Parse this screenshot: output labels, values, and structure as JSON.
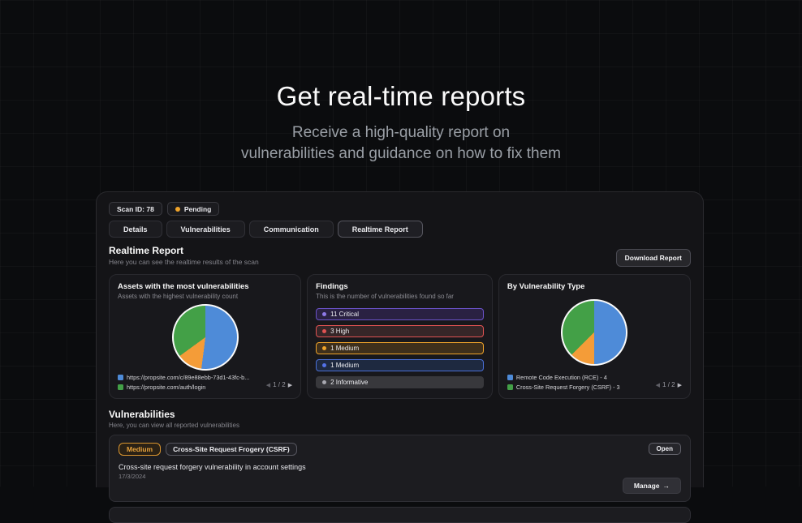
{
  "hero": {
    "title": "Get real-time reports",
    "subtitle_line1": "Receive a high-quality report on",
    "subtitle_line2": "vulnerabilities and guidance on how to fix them"
  },
  "panel": {
    "scan_badge": "Scan ID: 78",
    "status_badge": "Pending",
    "status_dot_color": "#f0a42a",
    "tabs": [
      {
        "label": "Details",
        "active": false
      },
      {
        "label": "Vulnerabilities",
        "active": false
      },
      {
        "label": "Communication",
        "active": false
      },
      {
        "label": "Realtime Report",
        "active": true
      }
    ],
    "section": {
      "title": "Realtime Report",
      "subtitle": "Here you can see the realtime results of the scan",
      "download_button": "Download Report"
    },
    "cards": {
      "assets": {
        "title": "Assets with the most vulnerabilities",
        "subtitle": "Assets with the highest vulnerability count",
        "legend": [
          {
            "color": "#4e8bd8",
            "label": "https://propsite.com/c/89e88ebb-73d1-43fc-b..."
          },
          {
            "color": "#43a047",
            "label": "https://propsite.com/auth/login"
          }
        ],
        "pagination": "1 / 2"
      },
      "findings": {
        "title": "Findings",
        "subtitle": "This is the number of vulnerabilities found so far",
        "rows": [
          {
            "label": "11 Critical",
            "dot": "#8f7ae8",
            "border": "#6a52c8",
            "bg": "#2a2142"
          },
          {
            "label": "3 High",
            "dot": "#e05252",
            "border": "#e05252",
            "bg": "#362628"
          },
          {
            "label": "1 Medium",
            "dot": "#f0a42a",
            "border": "#f0a42a",
            "bg": "#3e2f1b"
          },
          {
            "label": "1 Medium",
            "dot": "#5472e8",
            "border": "#4a6fd6",
            "bg": "#1e2940"
          },
          {
            "label": "2 Informative",
            "dot": "#a8a8b0",
            "border": "#38383c",
            "bg": "#38383c"
          }
        ]
      },
      "by_type": {
        "title": "By Vulnerability Type",
        "legend": [
          {
            "color": "#4e8bd8",
            "label": "Remote Code Execution (RCE) - 4"
          },
          {
            "color": "#43a047",
            "label": "Cross-Site Request Forgery (CSRF) - 3"
          }
        ],
        "pagination": "1 / 2"
      }
    },
    "vulnerabilities": {
      "title": "Vulnerabilities",
      "subtitle": "Here, you can view all reported vulnerabilities",
      "items": [
        {
          "severity": "Medium",
          "type": "Cross-Site Request Frogery (CSRF)",
          "status": "Open",
          "description": "Cross-site request forgery vulnerability in account settings",
          "date": "17/3/2024",
          "manage_label": "Manage"
        }
      ]
    }
  },
  "icons": {
    "prev": "◀",
    "next": "▶",
    "arrow_right": "→"
  },
  "chart_data": [
    {
      "type": "pie",
      "title": "Assets with the most vulnerabilities",
      "total": 100,
      "slices": [
        {
          "label": "https://propsite.com/c/89e88ebb-73d1-43fc-b...",
          "value": 52,
          "color": "#4e8bd8"
        },
        {
          "label": "",
          "value": 13,
          "color": "#f49c38"
        },
        {
          "label": "https://propsite.com/auth/login",
          "value": 35,
          "color": "#43a047"
        }
      ]
    },
    {
      "type": "pie",
      "title": "By Vulnerability Type",
      "total": 8,
      "slices": [
        {
          "label": "Remote Code Execution (RCE)",
          "value": 4,
          "color": "#4e8bd8"
        },
        {
          "label": "",
          "value": 1,
          "color": "#f49c38"
        },
        {
          "label": "Cross-Site Request Forgery (CSRF)",
          "value": 3,
          "color": "#43a047"
        }
      ]
    }
  ]
}
